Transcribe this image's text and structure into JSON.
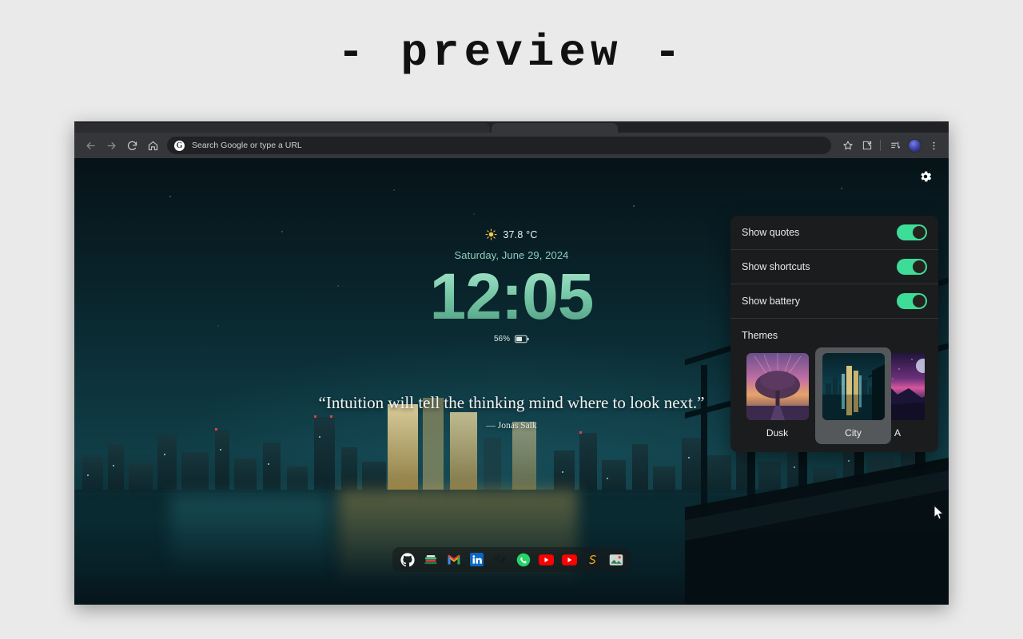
{
  "page": {
    "title": "- preview -"
  },
  "browser": {
    "nav": {
      "back": "back-arrow",
      "forward": "forward-arrow",
      "reload": "reload",
      "home": "home"
    },
    "omnibox": {
      "placeholder": "Search Google or type a URL",
      "value": "Search Google or type a URL",
      "search_engine_icon": "G"
    },
    "right_icons": [
      "bookmark-star",
      "extensions-puzzle",
      "reading-list",
      "profile-avatar",
      "chrome-menu"
    ]
  },
  "newtab": {
    "settings_gear": "gear-icon",
    "weather": {
      "icon": "sun-icon",
      "temperature": "37.8 °C"
    },
    "date": "Saturday, June 29, 2024",
    "clock": "12:05",
    "battery": {
      "percent": "56%",
      "icon": "battery-icon",
      "level": 56
    },
    "quote": {
      "text": "“Intuition will tell the thinking mind where to look next.”",
      "author": "— Jonas Salk"
    },
    "shortcuts": [
      {
        "name": "github",
        "label": "GitHub"
      },
      {
        "name": "books",
        "label": "Books"
      },
      {
        "name": "gmail",
        "label": "Gmail"
      },
      {
        "name": "linkedin",
        "label": "LinkedIn"
      },
      {
        "name": "scorpion",
        "label": "Scorpion"
      },
      {
        "name": "whatsapp",
        "label": "WhatsApp"
      },
      {
        "name": "youtube",
        "label": "YouTube"
      },
      {
        "name": "youtube-music",
        "label": "YouTube"
      },
      {
        "name": "sublime",
        "label": "Sublime"
      },
      {
        "name": "photos",
        "label": "Photos"
      }
    ]
  },
  "settings_panel": {
    "toggles": [
      {
        "label": "Show quotes",
        "on": true
      },
      {
        "label": "Show shortcuts",
        "on": true
      },
      {
        "label": "Show battery",
        "on": true
      }
    ],
    "themes_heading": "Themes",
    "themes": [
      {
        "label": "Dusk",
        "selected": false
      },
      {
        "label": "City",
        "selected": true
      },
      {
        "label": "A",
        "selected": false
      }
    ]
  },
  "colors": {
    "accent_green": "#3ddc97",
    "clock_gradient_top": "#a9e8cf",
    "clock_gradient_bottom": "#4f9b80",
    "panel_bg": "#1b1c1e",
    "toolbar_bg": "#35363a",
    "page_bg": "#eaeaea"
  }
}
